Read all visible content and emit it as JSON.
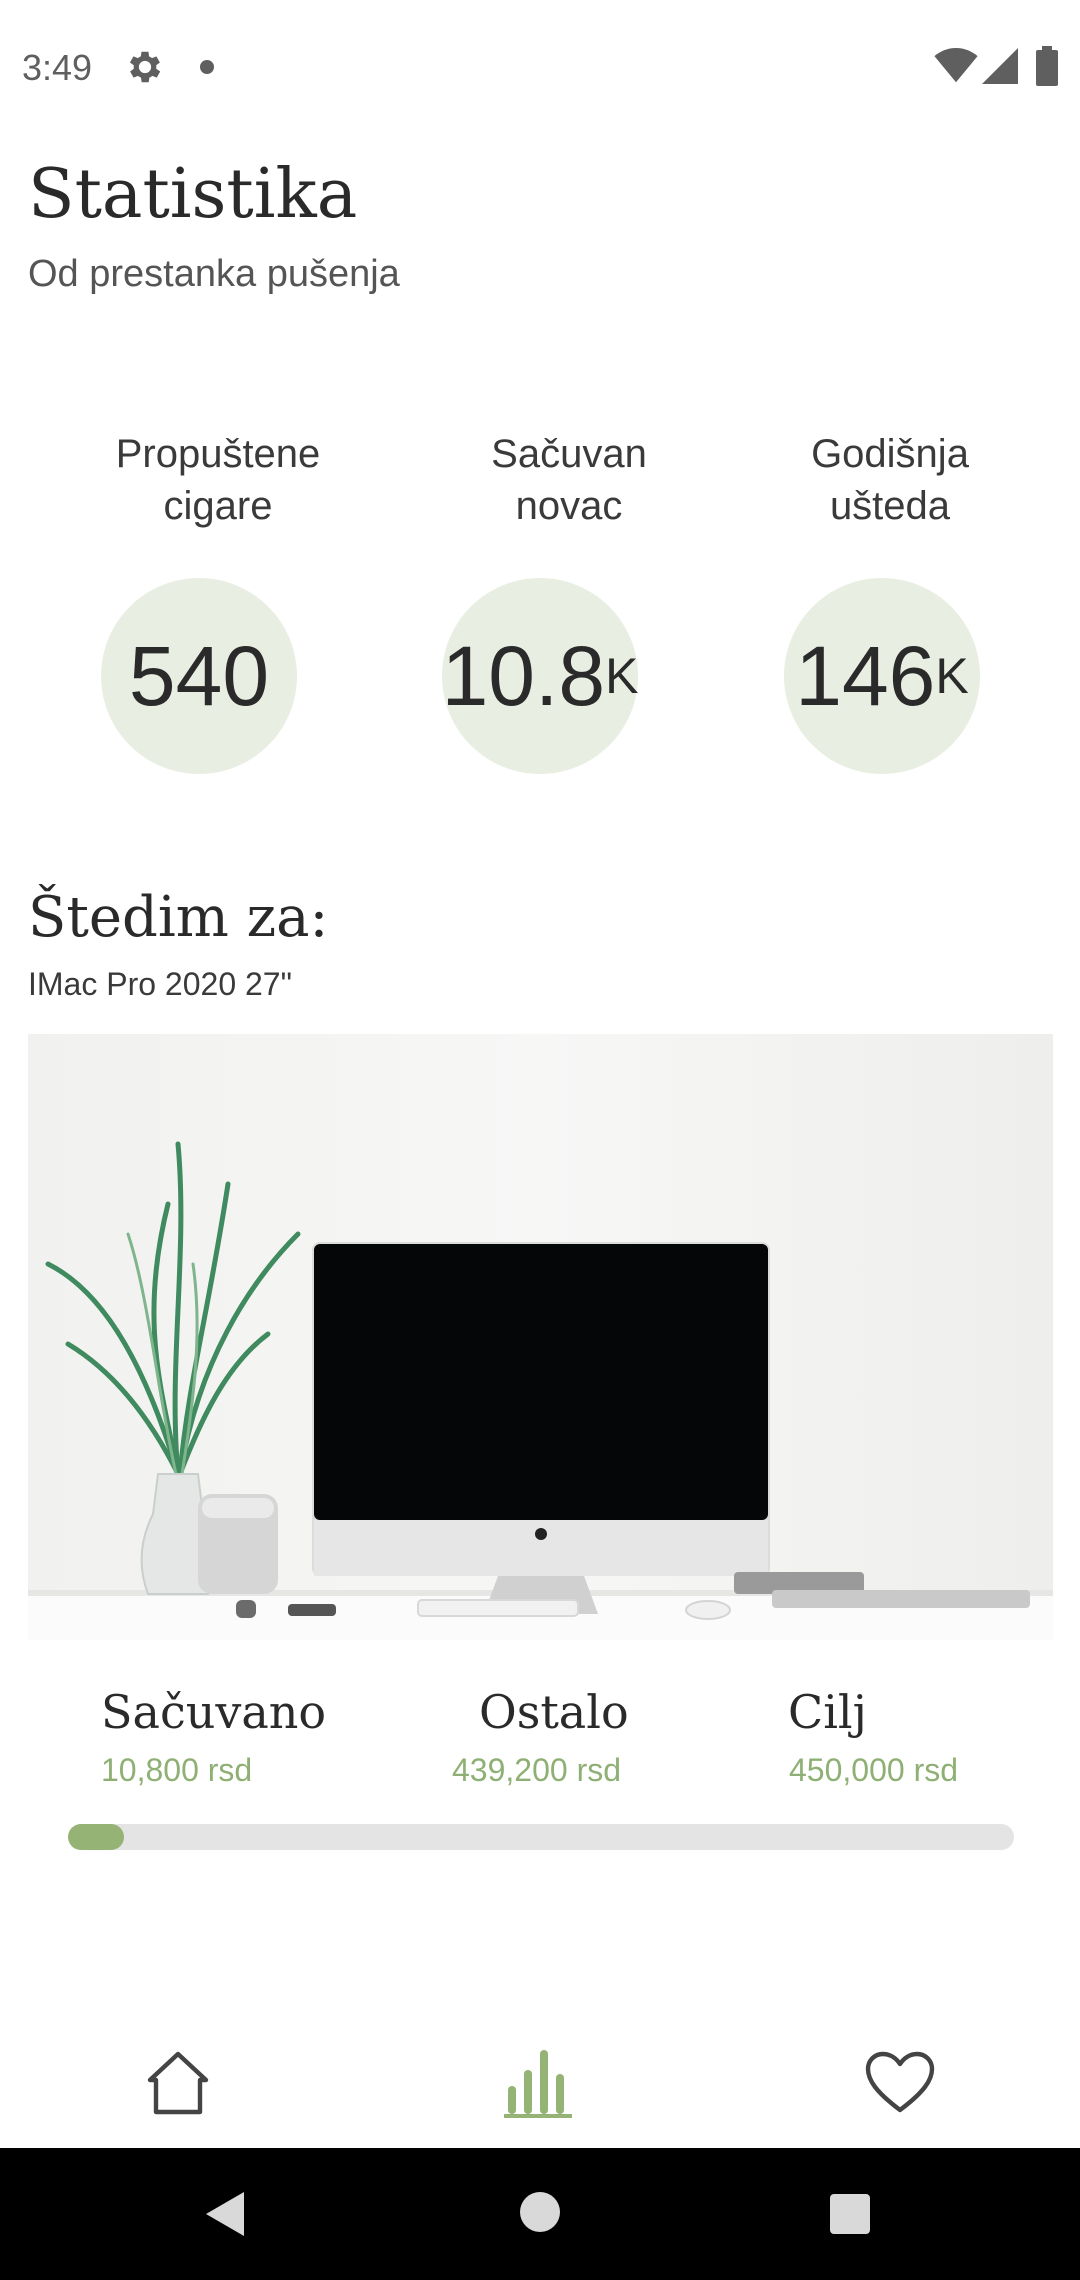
{
  "status_bar": {
    "time": "3:49",
    "icons": [
      "gear-icon",
      "notification-dot",
      "wifi-icon",
      "signal-icon",
      "battery-icon"
    ]
  },
  "header": {
    "title": "Statistika",
    "subtitle": "Od prestanka pušenja"
  },
  "stats": [
    {
      "label_line1": "Propuštene",
      "label_line2": "cigare",
      "value": "540",
      "unit": ""
    },
    {
      "label_line1": "Sačuvan",
      "label_line2": "novac",
      "value": "10.8",
      "unit": "K"
    },
    {
      "label_line1": "Godišnja",
      "label_line2": "ušteda",
      "value": "146",
      "unit": "K"
    }
  ],
  "goal": {
    "title": "Štedim za:",
    "item": "IMac Pro 2020 27\""
  },
  "money": {
    "saved_label": "Sačuvano",
    "saved_value": "10,800 rsd",
    "remaining_label": "Ostalo",
    "remaining_value": "439,200 rsd",
    "target_label": "Cilj",
    "target_value": "450,000 rsd"
  },
  "progress": {
    "fraction": 0.024
  },
  "bottom_nav": {
    "items": [
      "home-icon",
      "statistics-icon",
      "heart-icon"
    ],
    "active": "statistics-icon",
    "accent_color": "#94b375"
  },
  "colors": {
    "accent": "#94b375",
    "circle_bg": "#e9eee2",
    "money_value": "#8fb074"
  }
}
